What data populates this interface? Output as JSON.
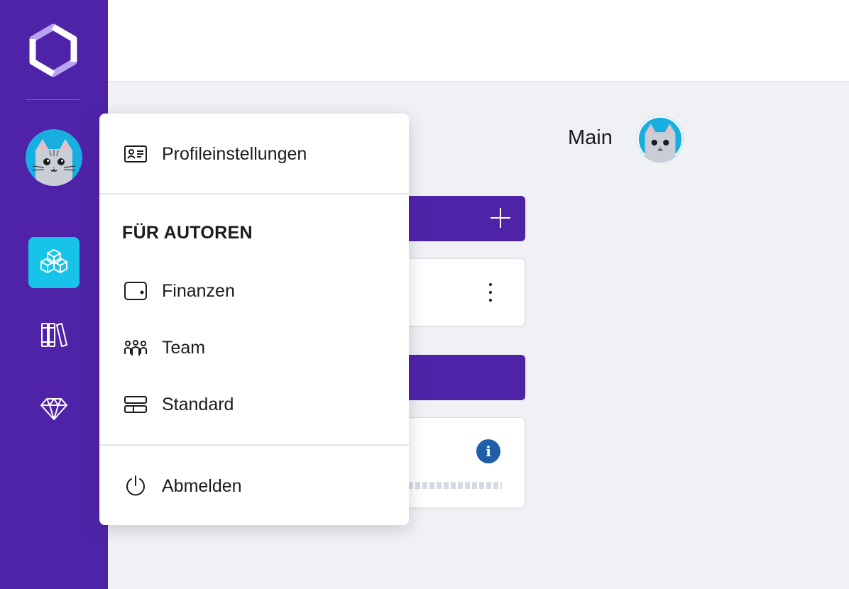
{
  "app": {
    "brand_color": "#4f23a8",
    "accent_color": "#17c3e8",
    "info_color": "#1e5fa8"
  },
  "sidebar": {
    "logo": "app-logo",
    "avatar": "cat-avatar",
    "items": [
      {
        "icon": "cubes-icon",
        "active": true
      },
      {
        "icon": "books-icon",
        "active": false
      },
      {
        "icon": "diamond-icon",
        "active": false
      }
    ]
  },
  "main": {
    "title": "Main",
    "avatar": "cat-avatar",
    "add_icon": "plus-icon",
    "menu_icon": "more-vertical-icon",
    "info_icon_text": "i"
  },
  "dropdown": {
    "profile_settings": "Profileinstellungen",
    "section_heading": "FÜR AUTOREN",
    "finances": "Finanzen",
    "team": "Team",
    "standard": "Standard",
    "logout": "Abmelden"
  }
}
